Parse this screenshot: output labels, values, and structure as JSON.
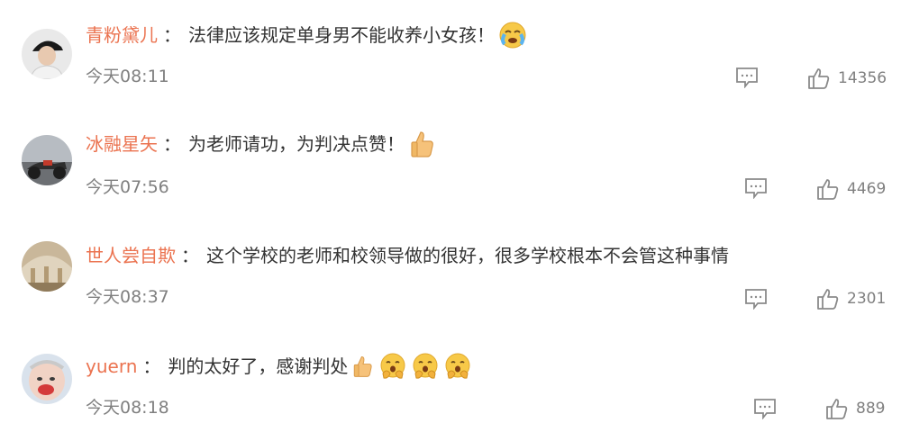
{
  "comments": [
    {
      "username": "青粉黛儿",
      "separator": "：",
      "text": "法律应该规定单身男不能收养小女孩！",
      "emojis": [
        "crying-face-emoji"
      ],
      "time": "今天08:11",
      "likes": "14356",
      "avatar": "avatar-person-black-cap"
    },
    {
      "username": "冰融星矢",
      "separator": "：",
      "text": "为老师请功，为判决点赞！",
      "emojis": [
        "thumbs-up-emoji"
      ],
      "time": "今天07:56",
      "likes": "4469",
      "avatar": "avatar-motorcycle-photo"
    },
    {
      "username": "世人尝自欺",
      "separator": "：",
      "text": "这个学校的老师和校领导做的很好，很多学校根本不会管这种事情",
      "emojis": [],
      "time": "今天08:37",
      "likes": "2301",
      "avatar": "avatar-classical-painting"
    },
    {
      "username": "yuern",
      "separator": "：",
      "text": "判的太好了，感谢判处",
      "emojis": [
        "thumbs-up-emoji",
        "clapping-face-emoji",
        "clapping-face-emoji",
        "clapping-face-emoji"
      ],
      "time": "今天08:18",
      "likes": "889",
      "avatar": "avatar-baby-photo"
    }
  ],
  "colors": {
    "username": "#eb7350",
    "text": "#333333",
    "meta": "#808080",
    "icon": "#8a8a8a"
  }
}
